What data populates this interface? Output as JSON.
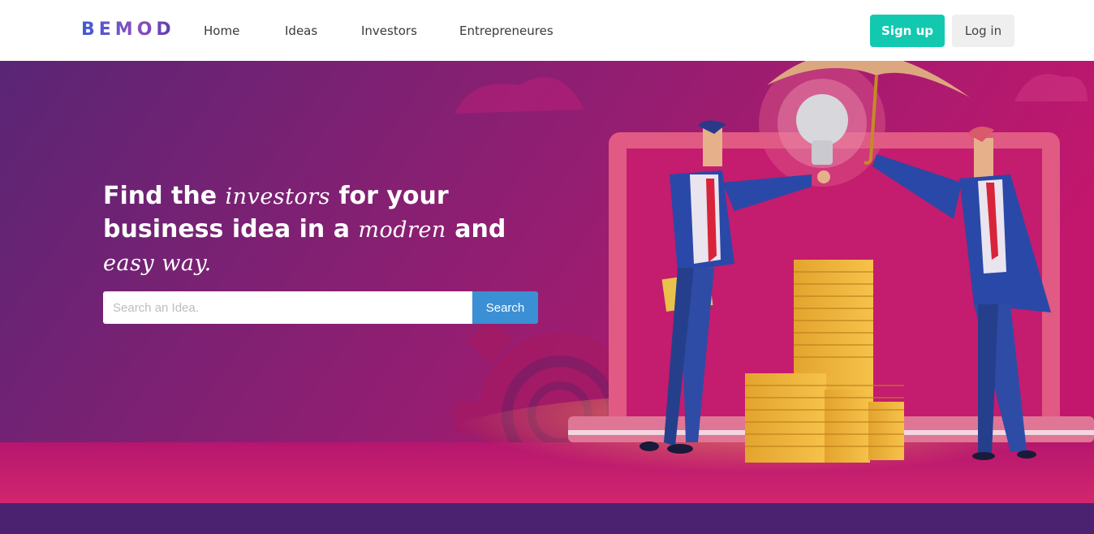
{
  "header": {
    "logo": "BEMOD",
    "nav": [
      "Home",
      "Ideas",
      "Investors",
      "Entrepreneures"
    ],
    "signup_label": "Sign up",
    "login_label": "Log in"
  },
  "hero": {
    "headline": {
      "part1": "Find the ",
      "script1": "investors",
      "part2": " for your business idea in a ",
      "script2": "modren",
      "part3": " and ",
      "script3": "easy way."
    },
    "search": {
      "placeholder": "Search an Idea.",
      "button_label": "Search"
    }
  },
  "colors": {
    "accent_teal": "#12c9b0",
    "search_blue": "#3b8fd4",
    "hero_purple": "#6a2170",
    "hero_magenta": "#b8156a"
  }
}
